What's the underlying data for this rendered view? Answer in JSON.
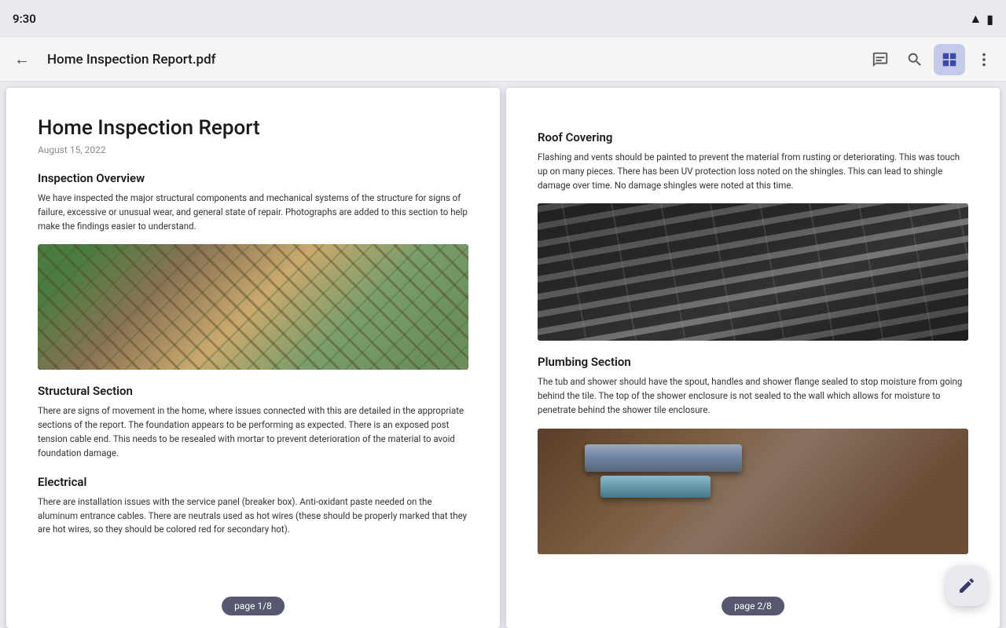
{
  "status": {
    "time": "9:30"
  },
  "toolbar": {
    "title": "Home Inspection Report.pdf",
    "back_label": "←",
    "icons": {
      "comment": "💬",
      "search": "🔍",
      "grid": "⊞",
      "more": "⋮"
    }
  },
  "page1": {
    "badge": "page 1/8",
    "doc_title": "Home Inspection Report",
    "doc_date": "August 15, 2022",
    "section1_heading": "Inspection Overview",
    "section1_text": "We have inspected the major structural components and mechanical systems of the structure for signs of failure, excessive or unusual wear, and general state of repair. Photographs are added to this section to help make the findings easier to understand.",
    "section2_heading": "Structural Section",
    "section2_text": "There are signs of movement in the home, where issues connected with this are detailed in the appropriate sections of the report. The foundation appears to be performing as expected. There is an exposed post tension cable end. This needs to be resealed with mortar to prevent deterioration of the material to avoid foundation damage.",
    "section3_heading": "Electrical",
    "section3_text": "There are installation issues with the service panel (breaker box). Anti-oxidant paste needed on the aluminum entrance cables. There are neutrals used as hot wires (these should be properly marked that they are hot wires, so they should be colored red for secondary hot)."
  },
  "page2": {
    "badge": "page 2/8",
    "section1_heading": "Roof Covering",
    "section1_text": "Flashing and vents should be painted to prevent the material from rusting or deteriorating. This was touch up on many pieces. There has been UV protection loss noted on the shingles. This can lead to shingle damage over time. No damage shingles were noted at this time.",
    "section2_heading": "Plumbing Section",
    "section2_text": "The tub and shower should have the spout, handles and shower flange sealed to stop moisture from going behind the tile. The top of the shower enclosure is not sealed to the wall which allows for moisture to penetrate behind the shower tile enclosure."
  },
  "fab": {
    "icon": "✏️"
  }
}
